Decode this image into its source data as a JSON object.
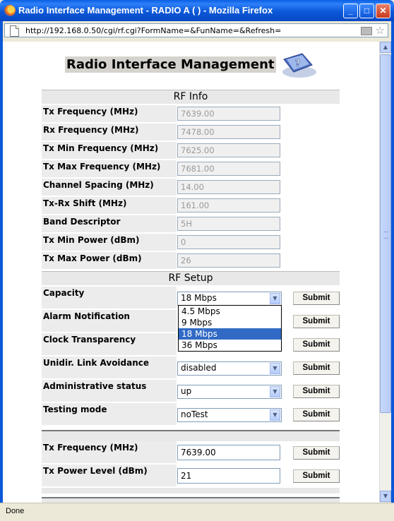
{
  "window": {
    "title": "Radio Interface Management - RADIO A ( ) - Mozilla Firefox",
    "minimize": "_",
    "maximize": "□",
    "close": "✕"
  },
  "address": {
    "url": "http://192.168.0.50/cgi/rf.cgi?FormName=&FunName=&Refresh="
  },
  "page": {
    "title": "Radio Interface Management"
  },
  "rf_info": {
    "header": "RF Info",
    "rows": [
      {
        "label": "Tx Frequency (MHz)",
        "value": "7639.00"
      },
      {
        "label": "Rx Frequency (MHz)",
        "value": "7478.00"
      },
      {
        "label": "Tx Min Frequency (MHz)",
        "value": "7625.00"
      },
      {
        "label": "Tx Max Frequency (MHz)",
        "value": "7681.00"
      },
      {
        "label": "Channel Spacing (MHz)",
        "value": "14.00"
      },
      {
        "label": "Tx-Rx Shift (MHz)",
        "value": "161.00"
      },
      {
        "label": "Band Descriptor",
        "value": "5H"
      },
      {
        "label": "Tx Min Power (dBm)",
        "value": "0"
      },
      {
        "label": "Tx Max Power (dBm)",
        "value": "26"
      }
    ]
  },
  "rf_setup": {
    "header": "RF Setup",
    "submit": "Submit",
    "rows": [
      {
        "label": "Capacity",
        "value": "18 Mbps"
      },
      {
        "label": "Alarm Notification",
        "value": ""
      },
      {
        "label": "Clock Transparency",
        "value": ""
      },
      {
        "label": "Unidir. Link Avoidance",
        "value": "disabled"
      },
      {
        "label": "Administrative status",
        "value": "up"
      },
      {
        "label": "Testing mode",
        "value": "noTest"
      }
    ],
    "capacity_options": [
      "4.5 Mbps",
      "9 Mbps",
      "18 Mbps",
      "36 Mbps"
    ],
    "capacity_selected": "18 Mbps"
  },
  "tx_settings": {
    "rows": [
      {
        "label": "Tx Frequency (MHz)",
        "value": "7639.00"
      },
      {
        "label": "Tx Power Level (dBm)",
        "value": "21"
      }
    ]
  },
  "status": {
    "text": "Done"
  },
  "colors": {
    "titlebar": "#0b58d8",
    "selection": "#316ac5",
    "section_bg": "#e8e8e8"
  }
}
